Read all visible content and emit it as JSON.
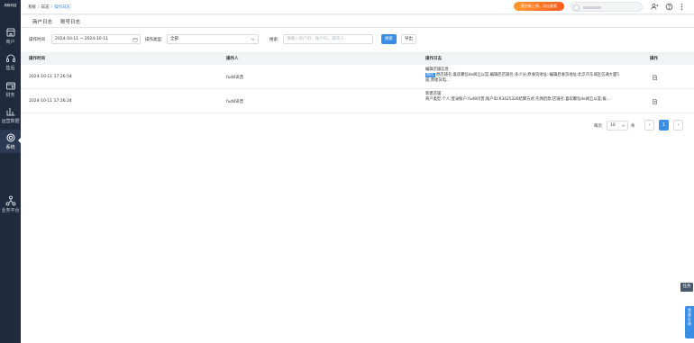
{
  "sidebar": {
    "logo": "风帆科技",
    "items": [
      {
        "label": "商户",
        "icon": "storefront-icon"
      },
      {
        "label": "售后",
        "icon": "headset-icon"
      },
      {
        "label": "财务",
        "icon": "wallet-icon"
      },
      {
        "label": "运营数据",
        "icon": "bar-chart-icon"
      },
      {
        "label": "系统",
        "icon": "gear-icon",
        "active": true
      },
      {
        "label": "业务平台",
        "icon": "network-icon"
      }
    ]
  },
  "topbar": {
    "breadcrumb": [
      "系统",
      "日志",
      "操作日志"
    ],
    "promo": "报名新上线，点击查看",
    "icons": [
      "user-switch-icon",
      "help-icon",
      "more-icon"
    ]
  },
  "tabs": [
    {
      "label": "商户日志"
    },
    {
      "label": "账号日志",
      "active": true
    }
  ],
  "filters": {
    "time_label": "操作时间",
    "time_value": "2024-10-11 ~ 2024-10-11",
    "type_label": "操作类型:",
    "type_value": "全部",
    "search_label": "搜索:",
    "search_placeholder": "请输入商户ID、账户ID、操作人",
    "search_button": "搜索",
    "export_button": "导出"
  },
  "table": {
    "columns": [
      "操作时间",
      "操作人",
      "操作日志",
      "操作"
    ],
    "rows": [
      {
        "time": "2024-10-11 17:26:54",
        "operator": "fud8讯普",
        "log_title": "编辑店铺信息",
        "log_tag": "原店",
        "log_body": "原店铺名:喜欢聚恺de闻丘以篮,编辑后店铺名:多少分;原收货地址:-编辑后收货地址:北京市东城区信通大厦5座;原收货电..."
      },
      {
        "time": "2024-10-11 17:26:24",
        "operator": "fud8讯普",
        "log_title": "新建店铺",
        "log_tag": "",
        "log_body": "商户类型:个人;登录账户:fud8讯普;账户ID:K3425326结算方式:先佣后款;店铺名:喜欢聚恺de闻丘以篮;报..."
      }
    ]
  },
  "pagination": {
    "per_page_label": "每页",
    "per_page_value": "10",
    "unit": "条",
    "prev": "‹",
    "current": "1",
    "next": "›"
  },
  "floating": {
    "task": "任务",
    "side": "我\n要\n反\n馈"
  }
}
